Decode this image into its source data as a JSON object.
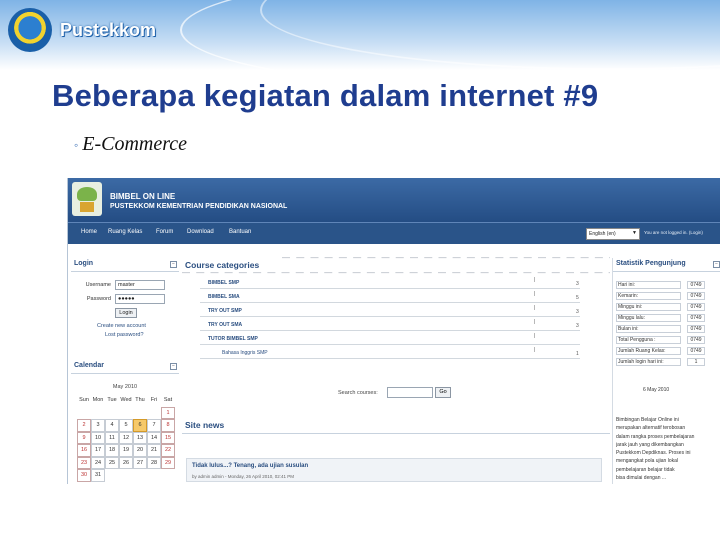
{
  "slide": {
    "logo_text": "Pustekkom",
    "title": "Beberapa kegiatan dalam internet  #9",
    "bullet": "E-Commerce"
  },
  "site": {
    "name": "BIMBEL ON LINE",
    "subtitle": "PUSTEKKOM KEMENTRIAN PENDIDIKAN NASIONAL",
    "nav": [
      "Home",
      "Ruang Kelas",
      "Forum",
      "Download",
      "Bantuan"
    ],
    "language": "English (en)",
    "login_status": "You are not logged in. (Login)",
    "login_block": {
      "title": "Login",
      "username_label": "Username",
      "username_value": "master",
      "password_label": "Password",
      "password_value": "●●●●●",
      "login_button": "Login",
      "create_account": "Create new account",
      "lost_password": "Lost password?"
    },
    "calendar": {
      "title": "Calendar",
      "month": "May 2010",
      "weekdays": [
        "Sun",
        "Mon",
        "Tue",
        "Wed",
        "Thu",
        "Fri",
        "Sat"
      ],
      "weeks": [
        [
          "",
          "",
          "",
          "",
          "",
          "",
          "1"
        ],
        [
          "2",
          "3",
          "4",
          "5",
          "6",
          "7",
          "8"
        ],
        [
          "9",
          "10",
          "11",
          "12",
          "13",
          "14",
          "15"
        ],
        [
          "16",
          "17",
          "18",
          "19",
          "20",
          "21",
          "22"
        ],
        [
          "23",
          "24",
          "25",
          "26",
          "27",
          "28",
          "29"
        ],
        [
          "30",
          "31",
          "",
          "",
          "",
          "",
          ""
        ]
      ],
      "today": "6"
    },
    "course_categories": {
      "title": "Course categories",
      "items": [
        {
          "name": "BIMBEL SMP",
          "count": "3"
        },
        {
          "name": "BIMBEL SMA",
          "count": "5"
        },
        {
          "name": "TRY OUT SMP",
          "count": "3"
        },
        {
          "name": "TRY OUT SMA",
          "count": "3"
        },
        {
          "name": "TUTOR BIMBEL SMP",
          "count": ""
        },
        {
          "name": "Bahasa Inggris SMP",
          "count": "1"
        }
      ],
      "search_label": "Search courses:",
      "search_button": "Go"
    },
    "site_news": {
      "title": "Site news",
      "headline": "Tidak lulus...? Tenang, ada ujian susulan",
      "meta": "by admin admin - Monday, 26 April 2010, 02:41 PM"
    },
    "statistik": {
      "title": "Statistik Pengunjung",
      "rows": [
        {
          "label": "Hari ini:",
          "value": "0749"
        },
        {
          "label": "Kemarin:",
          "value": "0749"
        },
        {
          "label": "Minggu ini:",
          "value": "0749"
        },
        {
          "label": "Minggu lalu:",
          "value": "0749"
        },
        {
          "label": "Bulan ini:",
          "value": "0749"
        },
        {
          "label": "Total Pengguna :",
          "value": "0749"
        },
        {
          "label": "Jumlah Ruang Kelas:",
          "value": "0749"
        },
        {
          "label": "Jumlah login hari ini:",
          "value": "1"
        }
      ],
      "date": "6 May 2010"
    },
    "info_lines": [
      "Bimbingan Belajar Online ini",
      "merupakan alternatif terobosan",
      "dalam rangka proses pembelajaran",
      "jarak jauh yang dikembangkan",
      "Pustekkom Depdiknas. Proses ini",
      "mengangkat pola ujian lokal",
      "pembelajaran belajar tidak",
      "bisa dimulai dengan ..."
    ]
  }
}
